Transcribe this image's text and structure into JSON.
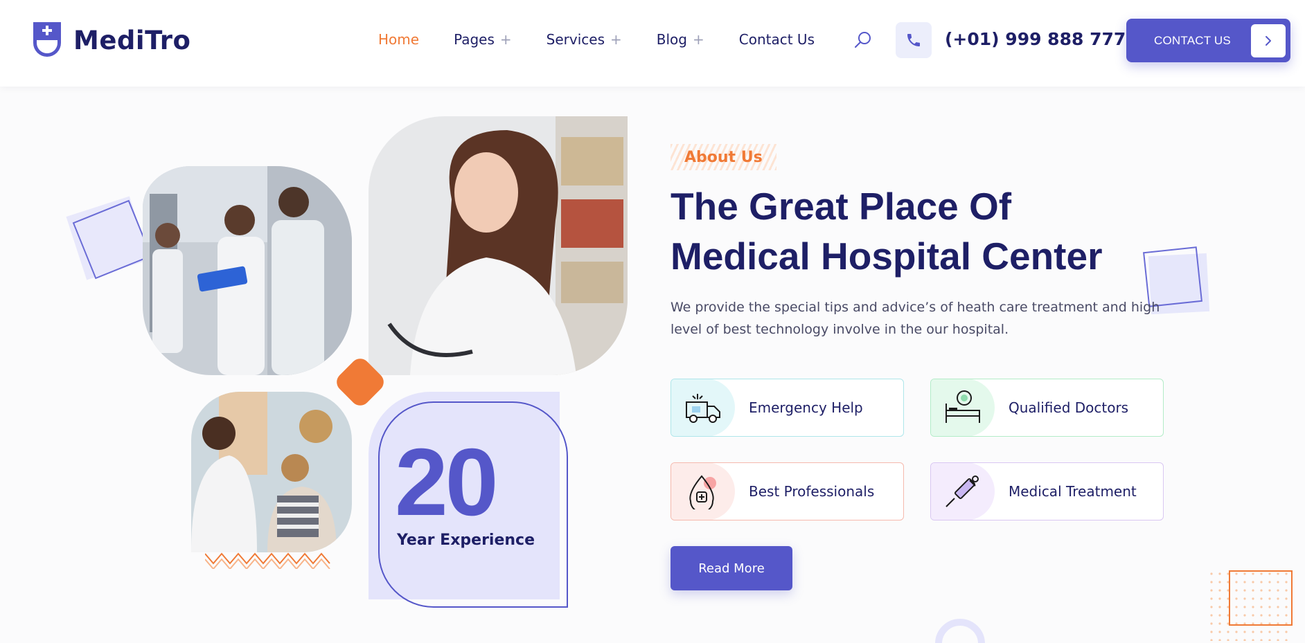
{
  "brand": {
    "name": "MediTro"
  },
  "nav": {
    "items": [
      {
        "label": "Home",
        "active": true,
        "has_plus": false
      },
      {
        "label": "Pages",
        "active": false,
        "has_plus": true
      },
      {
        "label": "Services",
        "active": false,
        "has_plus": true
      },
      {
        "label": "Blog",
        "active": false,
        "has_plus": true
      },
      {
        "label": "Contact Us",
        "active": false,
        "has_plus": false
      }
    ],
    "plus": "+"
  },
  "header": {
    "phone": "(+01) 999 888 777",
    "cta_label": "CONTACT US",
    "icons": [
      "search-icon",
      "phone-icon",
      "chevron-right-icon"
    ]
  },
  "experience": {
    "number": "20",
    "label": "Year Experience"
  },
  "about": {
    "tag": "About Us",
    "headline_line1": "The Great Place Of",
    "headline_line2": "Medical Hospital Center",
    "description": "We provide the special tips and advice’s of heath care treatment and high level of best technology involve in the our hospital."
  },
  "features": [
    {
      "label": "Emergency Help",
      "icon": "ambulance-icon"
    },
    {
      "label": "Qualified Doctors",
      "icon": "hospital-bed-icon"
    },
    {
      "label": "Best Professionals",
      "icon": "blood-drop-icon"
    },
    {
      "label": "Medical Treatment",
      "icon": "syringe-icon"
    }
  ],
  "read_more_label": "Read More",
  "colors": {
    "primary": "#5557c9",
    "navy": "#1e1f66",
    "accent": "#f07a36",
    "light_lavender": "#e4e4fb"
  }
}
